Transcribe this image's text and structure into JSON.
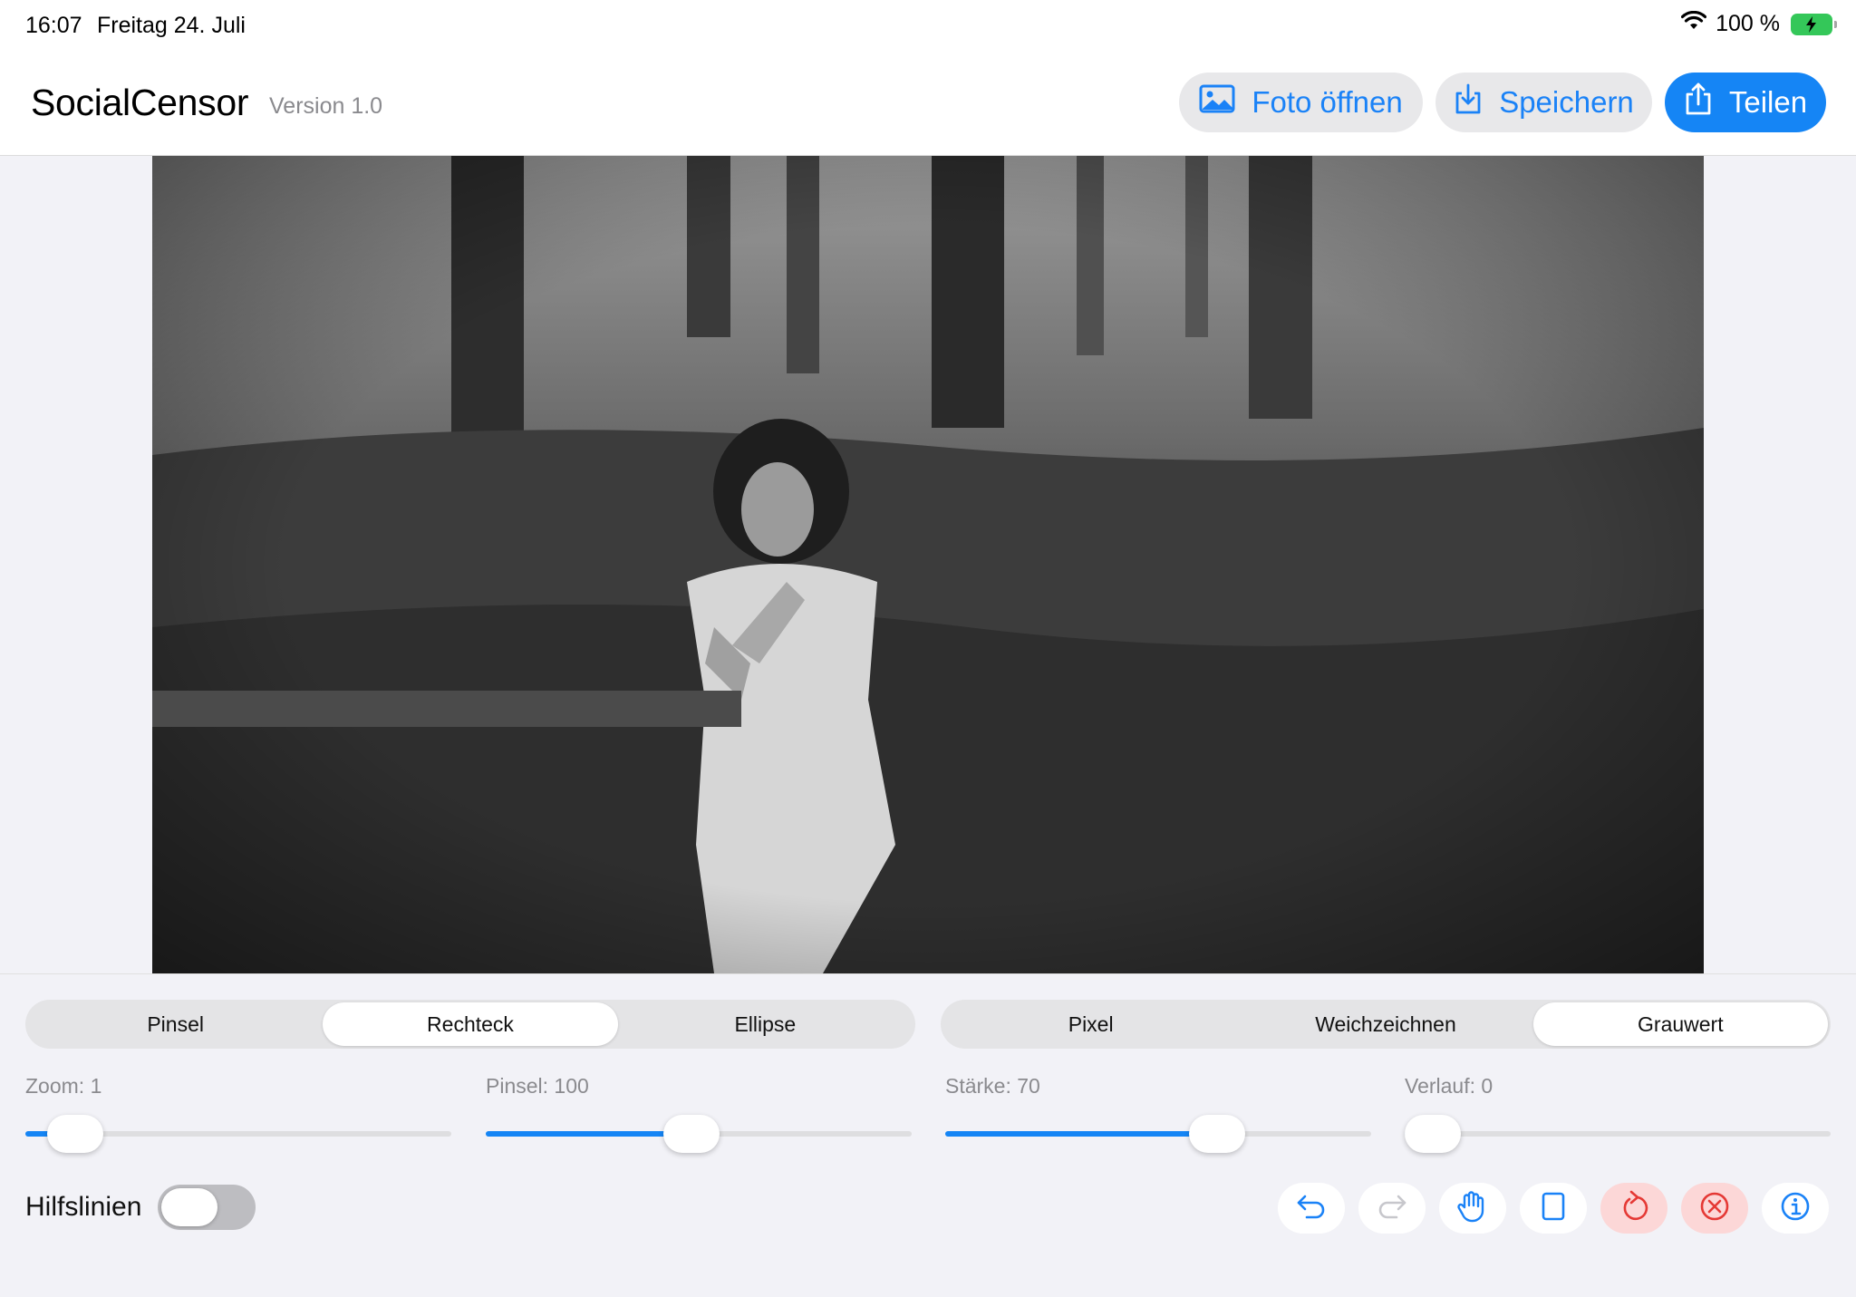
{
  "status_bar": {
    "time": "16:07",
    "date": "Freitag 24. Juli",
    "battery": "100 %"
  },
  "header": {
    "title": "SocialCensor",
    "version": "Version 1.0",
    "open_photo": "Foto öffnen",
    "save": "Speichern",
    "share": "Teilen"
  },
  "tools": {
    "shapes": [
      "Pinsel",
      "Rechteck",
      "Ellipse"
    ],
    "shape_selected": "Rechteck",
    "effects": [
      "Pixel",
      "Weichzeichnen",
      "Grauwert"
    ],
    "effect_selected": "Grauwert"
  },
  "sliders": {
    "zoom_label": "Zoom: 1",
    "zoom_fraction": 0.06,
    "brush_label": "Pinsel: 100",
    "brush_fraction": 0.48,
    "strength_label": "Stärke: 70",
    "strength_fraction": 0.66,
    "gradient_label": "Verlauf: 0",
    "gradient_fraction": 0.0
  },
  "guides": {
    "label": "Hilfslinien",
    "enabled": false
  },
  "colors": {
    "accent": "#1585f5",
    "destructive_bg": "#fcd7d7",
    "destructive_icon": "#e53935"
  },
  "icons": [
    "undo-icon",
    "redo-icon",
    "hand-icon",
    "rectangle-icon",
    "reset-icon",
    "clear-icon",
    "info-icon"
  ]
}
